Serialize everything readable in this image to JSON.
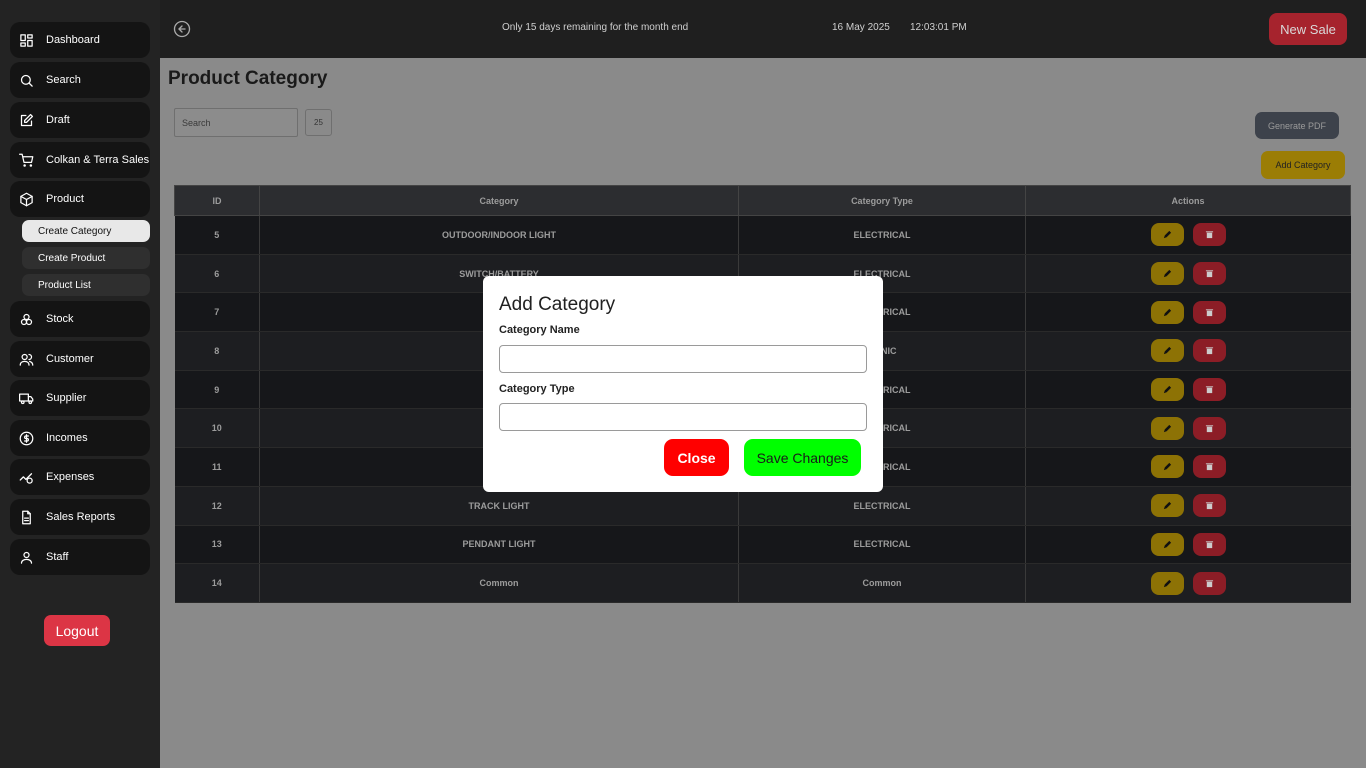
{
  "sidebar": {
    "items": [
      {
        "label": "Dashboard",
        "icon": "dashboard-icon"
      },
      {
        "label": "Search",
        "icon": "search-icon"
      },
      {
        "label": "Draft",
        "icon": "edit-icon"
      },
      {
        "label": "Colkan & Terra Sales",
        "icon": "cart-icon"
      },
      {
        "label": "Product",
        "icon": "box-icon"
      },
      {
        "label": "Stock",
        "icon": "stock-icon"
      },
      {
        "label": "Customer",
        "icon": "users-icon"
      },
      {
        "label": "Supplier",
        "icon": "truck-icon"
      },
      {
        "label": "Incomes",
        "icon": "dollar-icon"
      },
      {
        "label": "Expenses",
        "icon": "expenses-icon"
      },
      {
        "label": "Sales Reports",
        "icon": "report-icon"
      },
      {
        "label": "Staff",
        "icon": "user-icon"
      }
    ],
    "product_sub": [
      {
        "label": "Create Category",
        "active": true
      },
      {
        "label": "Create Product",
        "active": false
      },
      {
        "label": "Product List",
        "active": false
      }
    ],
    "logout_label": "Logout"
  },
  "topbar": {
    "notice": "Only 15 days remaining for the month end",
    "date": "16 May 2025",
    "time": "12:03:01 PM",
    "new_sale_label": "New Sale"
  },
  "main": {
    "title": "Product Category",
    "search_placeholder": "Search",
    "page_size": "25",
    "generate_pdf_label": "Generate PDF",
    "add_category_label": "Add Category"
  },
  "table": {
    "headers": [
      "ID",
      "Category",
      "Category Type",
      "Actions"
    ],
    "rows": [
      {
        "id": "5",
        "category": "OUTDOOR/INDOOR LIGHT",
        "type": "ELECTRICAL"
      },
      {
        "id": "6",
        "category": "SWITCH/BATTERY",
        "type": "ELECTRICAL"
      },
      {
        "id": "7",
        "category": "",
        "type": "ELECTRICAL"
      },
      {
        "id": "8",
        "category": "",
        "type": "RONIC"
      },
      {
        "id": "9",
        "category": "",
        "type": "ELECTRICAL"
      },
      {
        "id": "10",
        "category": "",
        "type": "ELECTRICAL"
      },
      {
        "id": "11",
        "category": "",
        "type": "ELECTRICAL"
      },
      {
        "id": "12",
        "category": "TRACK LIGHT",
        "type": "ELECTRICAL"
      },
      {
        "id": "13",
        "category": "PENDANT LIGHT",
        "type": "ELECTRICAL"
      },
      {
        "id": "14",
        "category": "Common",
        "type": "Common"
      }
    ]
  },
  "modal": {
    "title": "Add Category",
    "name_label": "Category Name",
    "name_value": "",
    "type_label": "Category Type",
    "type_value": "",
    "close_label": "Close",
    "save_label": "Save Changes"
  },
  "colors": {
    "sidebar_bg": "#232323",
    "new_sale": "#a6232d",
    "close": "#ff0000",
    "save": "#00ff00",
    "edit": "#8d7205",
    "delete": "#8c1d26"
  }
}
